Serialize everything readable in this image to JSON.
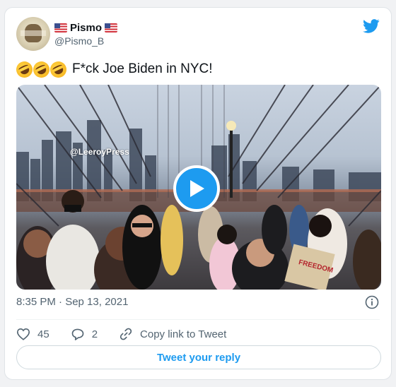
{
  "author": {
    "display_name": "Pismo",
    "handle": "@Pismo_B",
    "flag_left": "US flag",
    "flag_right": "US flag",
    "avatar": "avatar"
  },
  "tweet": {
    "emoji_icon": "rolling-on-the-floor-laughing-emoji",
    "emoji_count": 3,
    "text": "F*ck Joe Biden in NYC!"
  },
  "media": {
    "watermark": "@LeeroyPress",
    "play_icon": "play-icon"
  },
  "meta": {
    "timestamp": "8:35 PM · Sep 13, 2021"
  },
  "actions": {
    "like_count": "45",
    "reply_count": "2",
    "copy_link_label": "Copy link to Tweet"
  },
  "reply_button_label": "Tweet your reply",
  "colors": {
    "accent": "#1d9bf0",
    "text_primary": "#0f1419",
    "text_secondary": "#536471",
    "border": "#cfd9de"
  }
}
